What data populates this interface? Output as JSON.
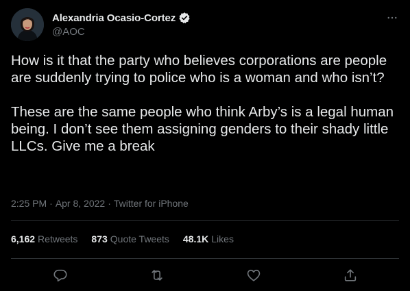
{
  "author": {
    "display_name": "Alexandria Ocasio-Cortez",
    "handle": "@AOC",
    "verified": true
  },
  "tweet": {
    "text": "How is it that the party who believes corporations are people are suddenly trying to police who is a woman and who isn’t?\n\nThese are the same people who think Arby’s is a legal human being. I don’t see them assigning genders to their shady little LLCs. Give me a break"
  },
  "meta": {
    "time": "2:25 PM",
    "separator1": "·",
    "date": "Apr 8, 2022",
    "separator2": "·",
    "source": "Twitter for iPhone"
  },
  "stats": {
    "retweets_count": "6,162",
    "retweets_label": "Retweets",
    "quotes_count": "873",
    "quotes_label": "Quote Tweets",
    "likes_count": "48.1K",
    "likes_label": "Likes"
  },
  "icons": {
    "more": "more-dots-icon",
    "verified": "verified-badge-icon",
    "reply": "reply-icon",
    "retweet": "retweet-icon",
    "like": "heart-icon",
    "share": "share-icon"
  },
  "colors": {
    "background": "#000000",
    "text_primary": "#e7e9ea",
    "text_secondary": "#71767b",
    "divider": "#2f3336"
  }
}
